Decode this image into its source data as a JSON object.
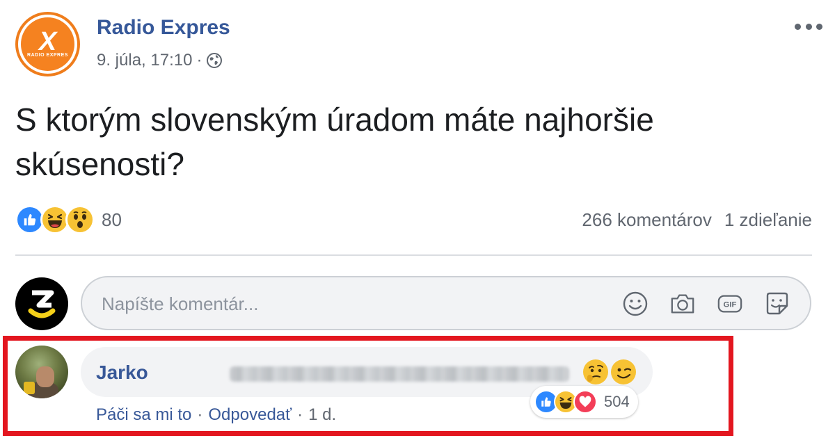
{
  "post": {
    "page_name": "Radio Expres",
    "logo_text": "RADIO EXPRES",
    "date": "9. júla, 17:10",
    "meta_separator": "·",
    "text": "S ktorým slovenským úradom máte najhoršie skúsenosti?",
    "icons": {
      "privacy": "globe-icon",
      "menu": "more-options-icon"
    }
  },
  "stats": {
    "reactions": [
      "like",
      "haha",
      "wow"
    ],
    "reaction_count": "80",
    "comments": "266 komentárov",
    "shares": "1 zdieľanie"
  },
  "composer": {
    "placeholder": "Napíšte komentár...",
    "icons": [
      "emoji-icon",
      "camera-icon",
      "gif-icon",
      "sticker-icon"
    ]
  },
  "comment": {
    "author": "Jarko",
    "text_blurred": true,
    "emojis": [
      "thinking",
      "wink"
    ],
    "reactions": [
      "like",
      "haha",
      "love"
    ],
    "reaction_count": "504",
    "actions": {
      "like": "Páči sa mi to",
      "reply": "Odpovedať",
      "time": "1 d.",
      "separator": "·"
    }
  },
  "colors": {
    "link": "#385898",
    "page_name": "#365899",
    "highlight": "#e3161f",
    "like_blue": "#2d88ff",
    "emoji_yellow": "#f7c234",
    "love_red": "#f33e58",
    "logo_orange": "#f58220"
  }
}
